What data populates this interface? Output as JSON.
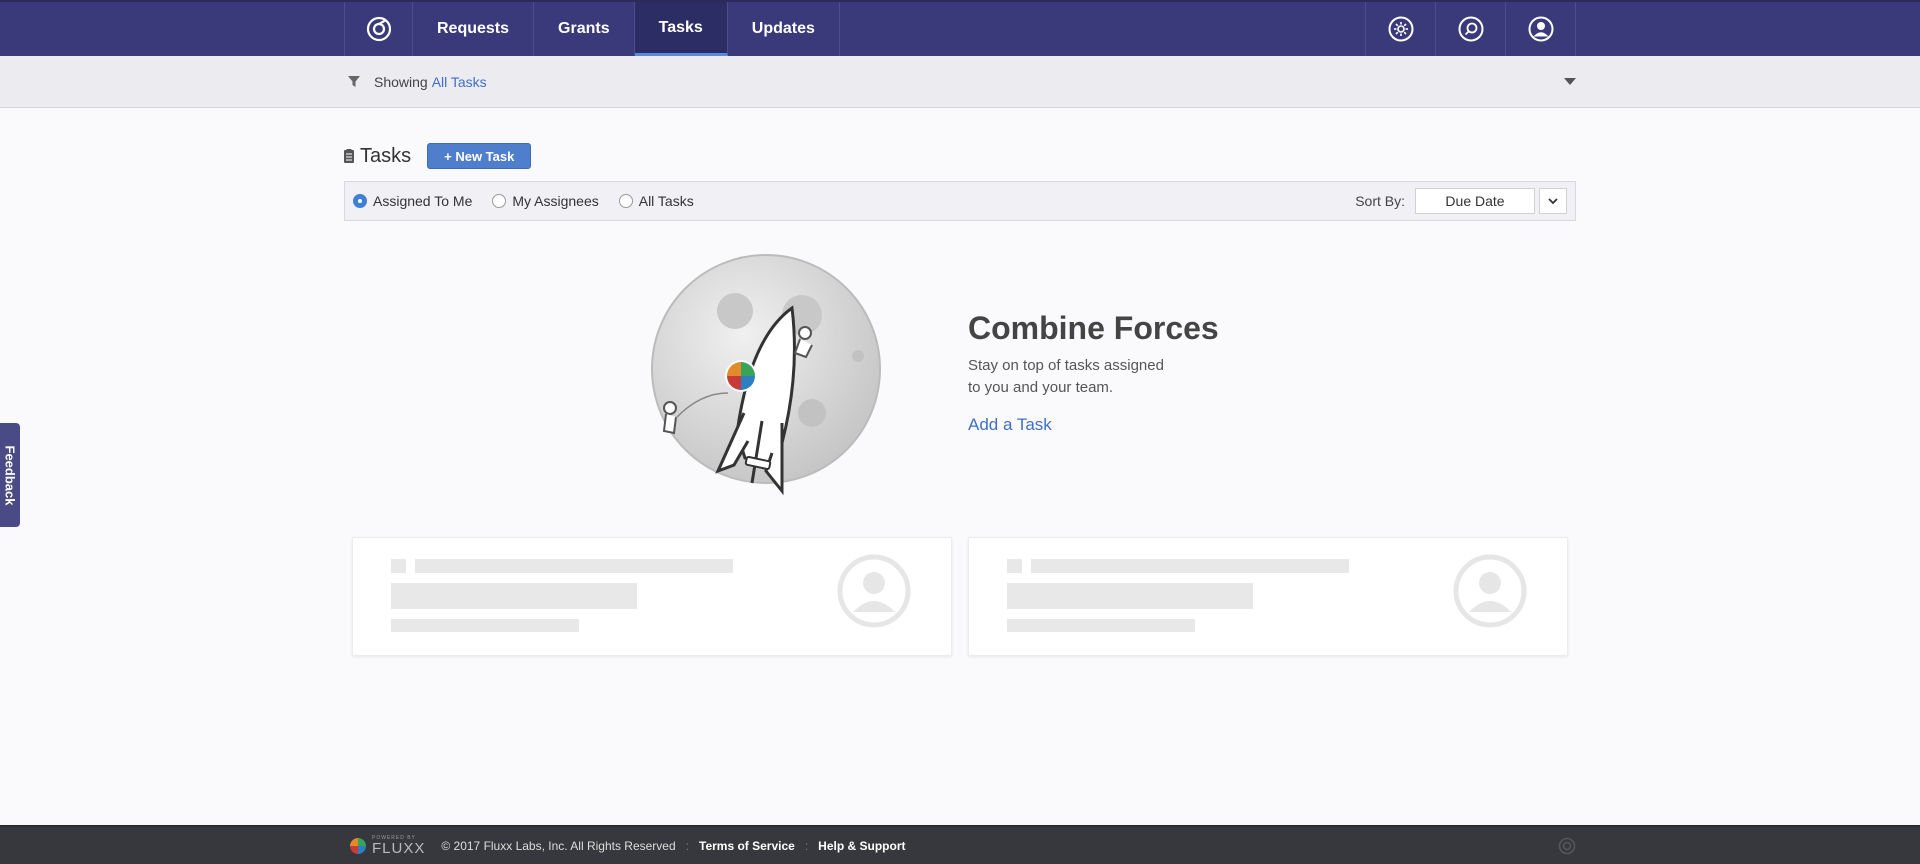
{
  "nav": {
    "tabs": [
      {
        "label": "Requests"
      },
      {
        "label": "Grants"
      },
      {
        "label": "Tasks",
        "active": true
      },
      {
        "label": "Updates"
      }
    ],
    "icons": [
      "settings-icon",
      "search-icon",
      "user-icon"
    ]
  },
  "filter": {
    "prefix": "Showing",
    "value": "All Tasks"
  },
  "tasks": {
    "title": "Tasks",
    "new_button": "+ New Task",
    "options": [
      {
        "label": "Assigned To Me",
        "selected": true
      },
      {
        "label": "My Assignees",
        "selected": false
      },
      {
        "label": "All Tasks",
        "selected": false
      }
    ],
    "sort_label": "Sort By:",
    "sort_value": "Due Date"
  },
  "empty_state": {
    "heading": "Combine Forces",
    "line1": "Stay on top of tasks assigned",
    "line2": "to you and your team.",
    "cta": "Add a Task"
  },
  "feedback": {
    "label": "Feedback"
  },
  "footer": {
    "powered_small": "POWERED BY",
    "powered_brand": "FLUXX",
    "copyright": "© 2017 Fluxx Labs, Inc. All Rights Reserved",
    "terms": "Terms of Service",
    "help": "Help & Support"
  },
  "colors": {
    "nav_bg": "#3a3a7a",
    "accent": "#4f7fcc",
    "link": "#3f6fc4",
    "footer_bg": "#37383d"
  }
}
